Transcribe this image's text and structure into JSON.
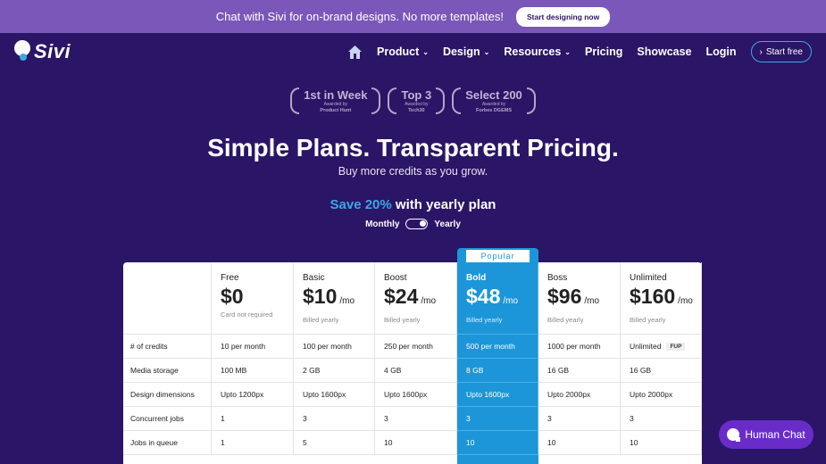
{
  "banner": {
    "text": "Chat with Sivi for on-brand designs. No more templates!",
    "button": "Start designing now"
  },
  "nav": {
    "logo": "Sivi",
    "items": [
      {
        "label": "Product",
        "dropdown": true
      },
      {
        "label": "Design",
        "dropdown": true
      },
      {
        "label": "Resources",
        "dropdown": true
      },
      {
        "label": "Pricing",
        "dropdown": false
      },
      {
        "label": "Showcase",
        "dropdown": false
      },
      {
        "label": "Login",
        "dropdown": false
      }
    ],
    "cta": "Start free"
  },
  "awards": [
    {
      "title": "1st in Week",
      "line1": "Awarded by",
      "line2": "Product Hunt"
    },
    {
      "title": "Top 3",
      "line1": "Awarded by",
      "line2": "Tech30"
    },
    {
      "title": "Select 200",
      "line1": "Awarded by",
      "line2": "Forbes DGEMS"
    }
  ],
  "hero": {
    "title": "Simple Plans. Transparent Pricing.",
    "subtitle": "Buy more credits as you grow."
  },
  "billing": {
    "save_highlight": "Save 20%",
    "save_rest": " with yearly plan",
    "monthly": "Monthly",
    "yearly": "Yearly",
    "selected": "Yearly"
  },
  "popular_label": "Popular",
  "plans": [
    {
      "name": "Free",
      "price": "$0",
      "per": "",
      "billing": "Card not required"
    },
    {
      "name": "Basic",
      "price": "$10",
      "per": "/mo",
      "billing": "Billed yearly"
    },
    {
      "name": "Boost",
      "price": "$24",
      "per": "/mo",
      "billing": "Billed yearly"
    },
    {
      "name": "Bold",
      "price": "$48",
      "per": "/mo",
      "billing": "Billed yearly"
    },
    {
      "name": "Boss",
      "price": "$96",
      "per": "/mo",
      "billing": "Billed yearly"
    },
    {
      "name": "Unlimited",
      "price": "$160",
      "per": "/mo",
      "billing": "Billed yearly"
    }
  ],
  "rows": [
    {
      "label": "# of credits",
      "values": [
        "10 per month",
        "100 per month",
        "250 per month",
        "500 per month",
        "1000 per month",
        "Unlimited"
      ],
      "badge": "FUP"
    },
    {
      "label": "Media storage",
      "values": [
        "100 MB",
        "2 GB",
        "4 GB",
        "8 GB",
        "16 GB",
        "16 GB"
      ]
    },
    {
      "label": "Design dimensions",
      "values": [
        "Upto 1200px",
        "Upto 1600px",
        "Upto 1600px",
        "Upto 1600px",
        "Upto 2000px",
        "Upto 2000px"
      ]
    },
    {
      "label": "Concurrent jobs",
      "values": [
        "1",
        "3",
        "3",
        "3",
        "3",
        "3"
      ]
    },
    {
      "label": "Jobs in queue",
      "values": [
        "1",
        "5",
        "10",
        "10",
        "10",
        "10"
      ]
    }
  ],
  "chat": {
    "label": "Human Chat"
  },
  "colors": {
    "background": "#2b1566",
    "banner": "#7a57b8",
    "accent": "#3ba8e8",
    "highlight_column": "#1c96d8",
    "chat": "#6a2cc9"
  }
}
